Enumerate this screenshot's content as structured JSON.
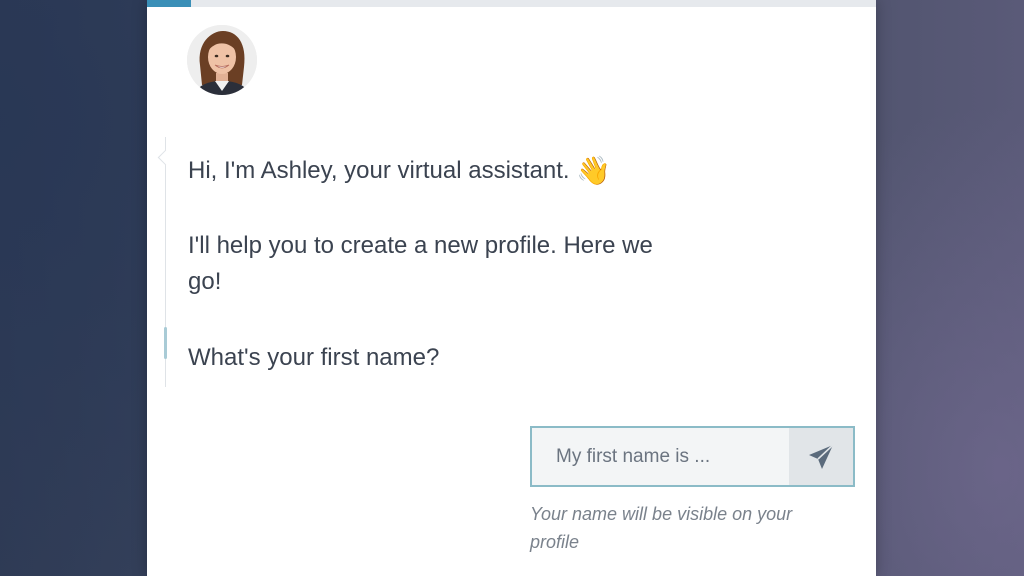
{
  "progress": {
    "value": 0.06,
    "color": "#3a8fb7"
  },
  "assistant": {
    "avatar_icon": "woman-portrait-avatar"
  },
  "message": {
    "greeting": "Hi, I'm Ashley, your virtual assistant.",
    "greeting_emoji": "👋",
    "intro": "I'll help you to create a new profile. Here we go!",
    "question": "What's your first name?"
  },
  "reply": {
    "placeholder": "My first name is ...",
    "value": "",
    "send_icon": "paper-plane-send-icon",
    "hint": "Your name will be visible on your profile"
  },
  "colors": {
    "accent": "#3a8fb7",
    "input_border": "#8bbbc7",
    "text": "#3b4350",
    "hint": "#7a828c"
  }
}
